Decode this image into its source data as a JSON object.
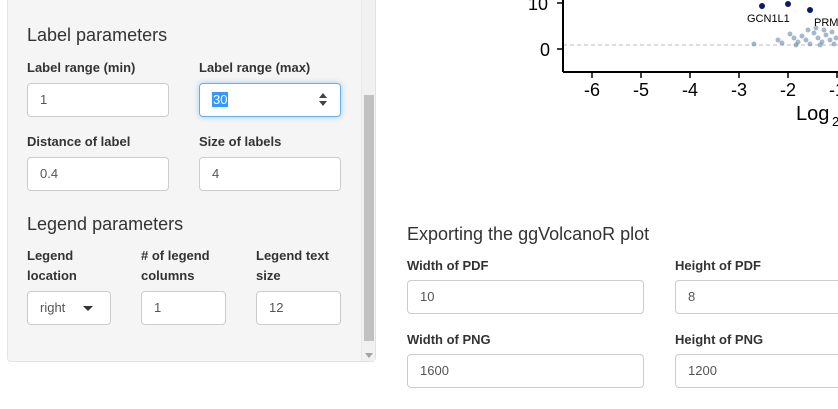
{
  "label_params": {
    "title": "Label parameters",
    "min_label": "Label range (min)",
    "min_value": "1",
    "max_label": "Label range (max)",
    "max_value": "30",
    "distance_label": "Distance of label",
    "distance_value": "0.4",
    "size_label": "Size of labels",
    "size_value": "4"
  },
  "legend_params": {
    "title": "Legend parameters",
    "location_label_line1": "Legend",
    "location_label_line2": "location",
    "location_value": "right",
    "columns_label_line1": "# of legend",
    "columns_label_line2": "columns",
    "columns_value": "1",
    "textsize_label_line1": "Legend text",
    "textsize_label_line2": "size",
    "textsize_value": "12"
  },
  "plot": {
    "y_ticks": [
      "10",
      "0"
    ],
    "x_ticks": [
      "-6",
      "-5",
      "-4",
      "-3",
      "-2",
      "-1"
    ],
    "x_label_partial": "Log",
    "x_label_sub": "2",
    "gene_labels": [
      "GCN1L1",
      "PRM"
    ],
    "point_color_dark": "#0a1a6e",
    "point_color_light": "#5b7fa6"
  },
  "export": {
    "title": "Exporting the ggVolcanoR plot",
    "pdf_width_label": "Width of PDF",
    "pdf_width_value": "10",
    "pdf_height_label": "Height of PDF",
    "pdf_height_value": "8",
    "png_width_label": "Width of PNG",
    "png_width_value": "1600",
    "png_height_label": "Height of PNG",
    "png_height_value": "1200"
  }
}
